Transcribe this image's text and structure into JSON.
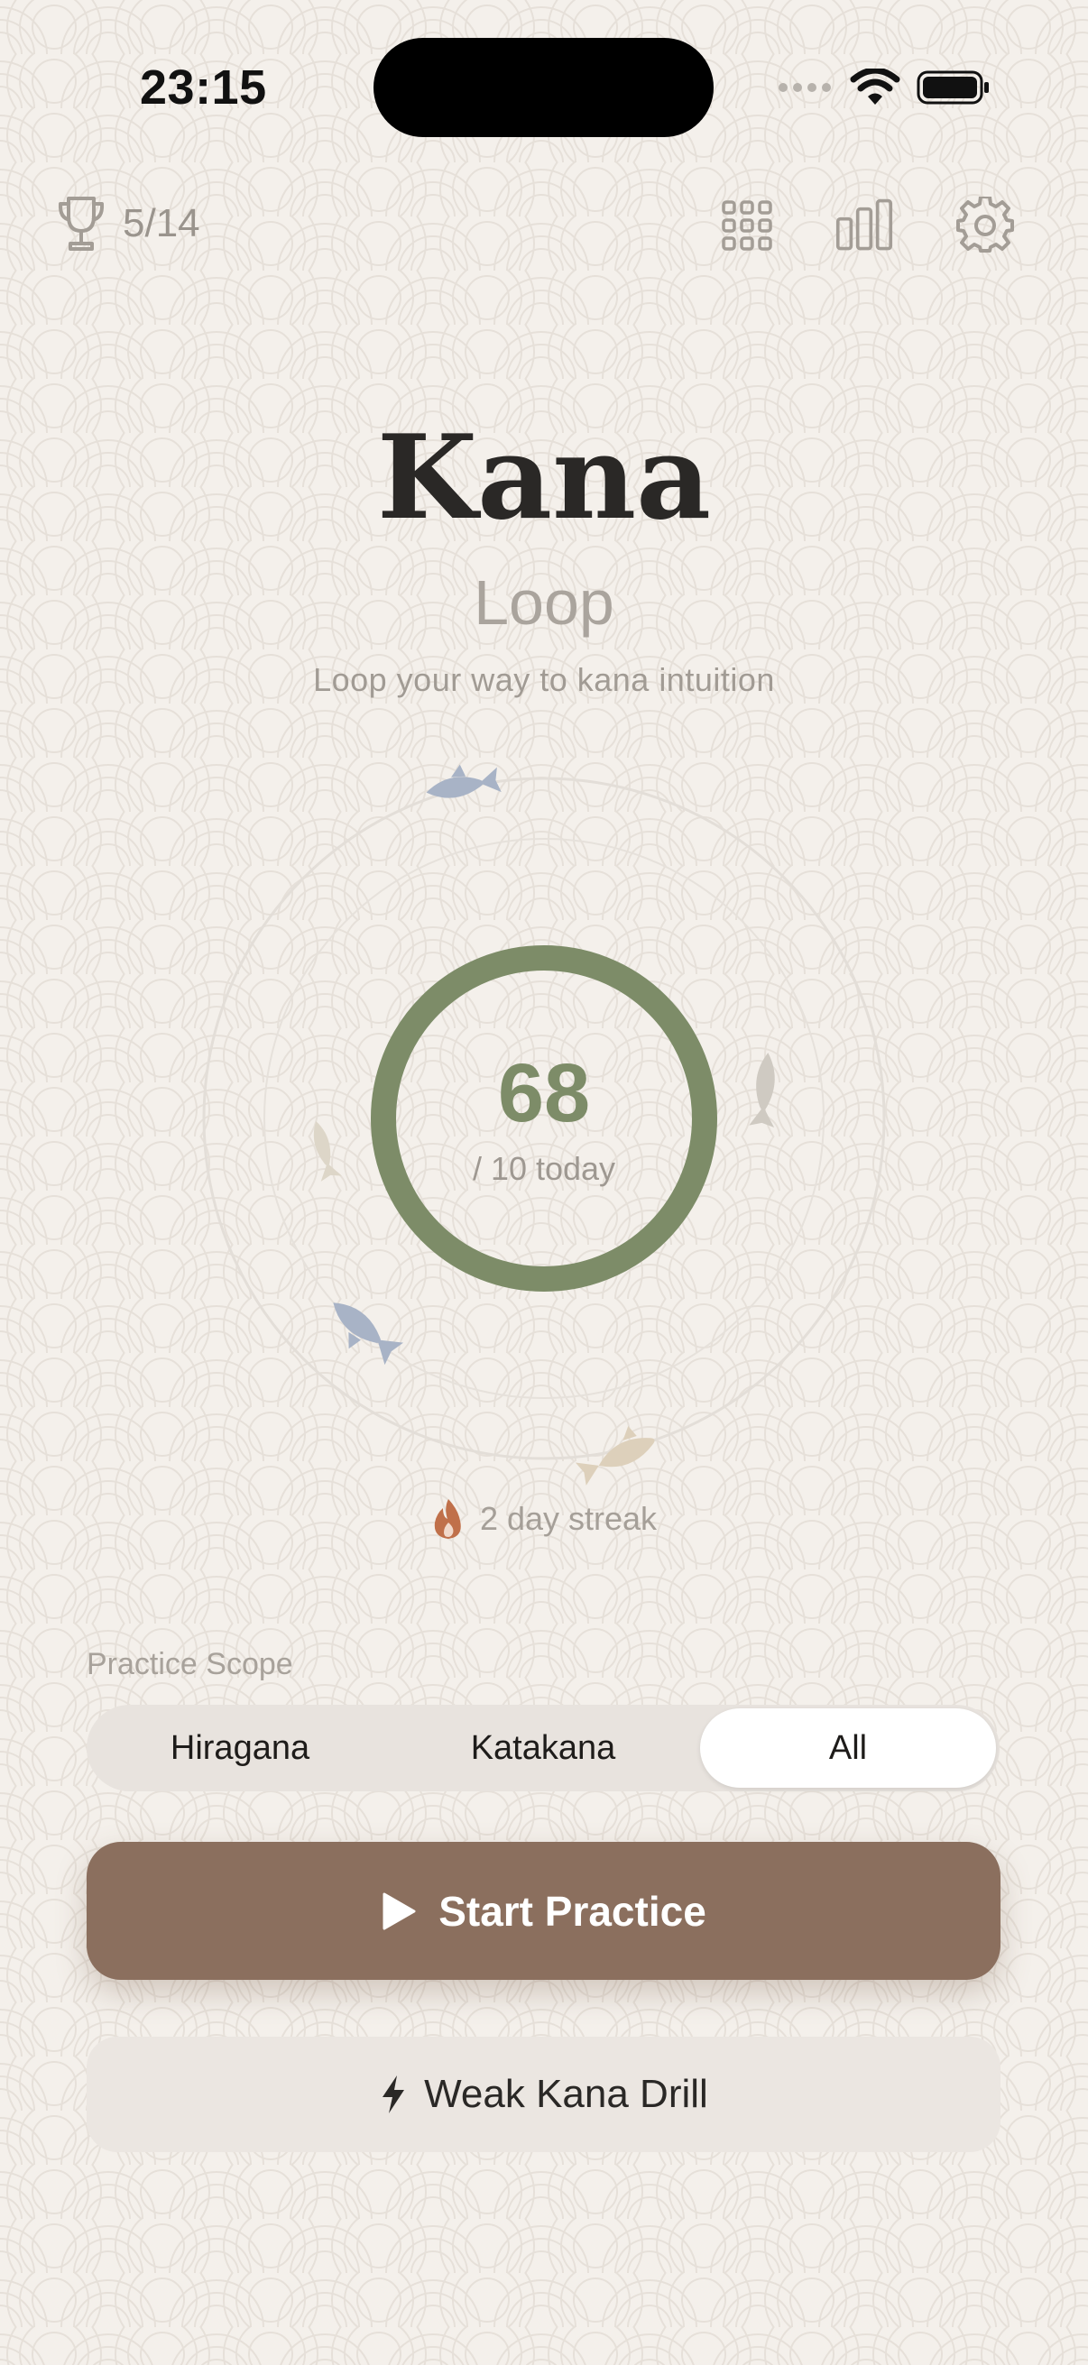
{
  "status_bar": {
    "time": "23:15",
    "signal": "signal-dots-icon",
    "wifi": "wifi-icon",
    "battery": "battery-full-icon"
  },
  "top_bar": {
    "achievements": {
      "count": "5/14",
      "icon": "trophy-icon"
    },
    "actions": [
      {
        "name": "kana-grid-button",
        "icon": "grid-icon"
      },
      {
        "name": "stats-button",
        "icon": "bar-chart-icon"
      },
      {
        "name": "settings-button",
        "icon": "gear-icon"
      }
    ]
  },
  "header": {
    "title": "Kana",
    "subtitle": "Loop",
    "tagline": "Loop your way to kana intuition"
  },
  "daily_progress": {
    "value": "68",
    "goal_label": "/ 10 today",
    "fill_fraction": 1.0,
    "ring_color": "#7d8c68"
  },
  "streak": {
    "text": "2 day streak",
    "icon": "flame-icon",
    "color": "#c0704a"
  },
  "scope": {
    "label": "Practice Scope",
    "options": [
      "Hiragana",
      "Katakana",
      "All"
    ],
    "selected": "All"
  },
  "actions": {
    "start": {
      "label": "Start Practice",
      "icon": "play-icon",
      "color": "#8b6f5e"
    },
    "weak_drill": {
      "label": "Weak Kana Drill",
      "icon": "bolt-icon"
    }
  },
  "colors": {
    "background": "#f4f0eb",
    "accent": "#7d8c68",
    "brand": "#8b6f5e",
    "text": "#2a2826",
    "muted": "#a19b94"
  }
}
